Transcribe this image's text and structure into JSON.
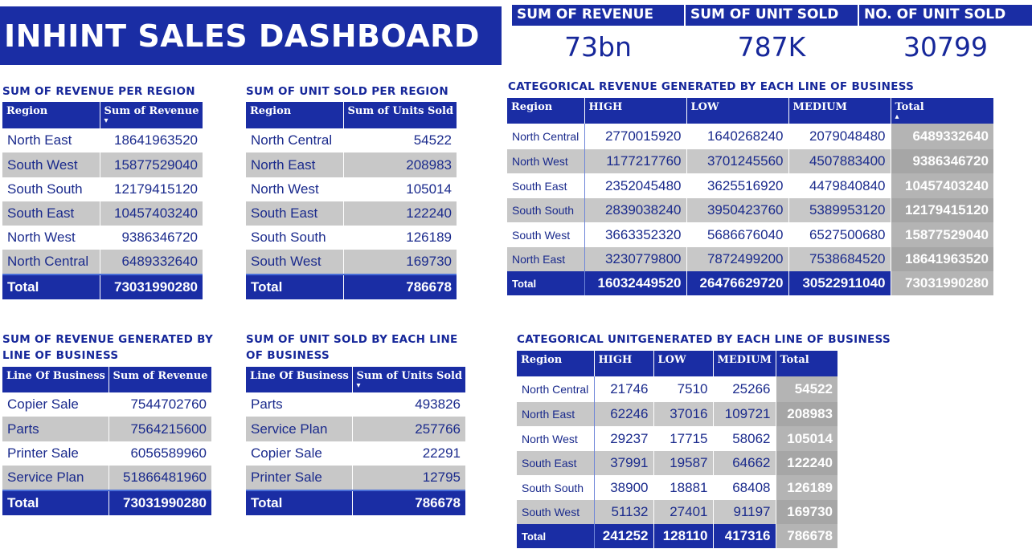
{
  "dashboard_title": "INHINT SALES DASHBOARD",
  "kpis": [
    {
      "label": "SUM OF REVENUE",
      "value": "73bn"
    },
    {
      "label": "SUM OF UNIT SOLD",
      "value": "787K"
    },
    {
      "label": "NO. OF UNIT SOLD",
      "value": "30799"
    }
  ],
  "revenue_by_region": {
    "title": "SUM OF REVENUE PER REGION",
    "headers": [
      "Region",
      "Sum of Revenue"
    ],
    "rows": [
      [
        "North East",
        "18641963520"
      ],
      [
        "South West",
        "15877529040"
      ],
      [
        "South South",
        "12179415120"
      ],
      [
        "South East",
        "10457403240"
      ],
      [
        "North West",
        "9386346720"
      ],
      [
        "North Central",
        "6489332640"
      ]
    ],
    "total": [
      "Total",
      "73031990280"
    ]
  },
  "units_by_region": {
    "title": "SUM OF UNIT SOLD PER REGION",
    "headers": [
      "Region",
      "Sum of Units Sold"
    ],
    "rows": [
      [
        "North Central",
        "54522"
      ],
      [
        "North East",
        "208983"
      ],
      [
        "North West",
        "105014"
      ],
      [
        "South East",
        "122240"
      ],
      [
        "South South",
        "126189"
      ],
      [
        "South West",
        "169730"
      ]
    ],
    "total": [
      "Total",
      "786678"
    ]
  },
  "revenue_by_lob": {
    "title_line1": "SUM OF REVENUE GENERATED BY",
    "title_line2": "LINE OF BUSINESS",
    "headers": [
      "Line Of Business",
      "Sum of Revenue"
    ],
    "rows": [
      [
        "Copier Sale",
        "7544702760"
      ],
      [
        "Parts",
        "7564215600"
      ],
      [
        "Printer Sale",
        "6056589960"
      ],
      [
        "Service Plan",
        "51866481960"
      ]
    ],
    "total": [
      "Total",
      "73031990280"
    ]
  },
  "units_by_lob": {
    "title_line1": "SUM OF UNIT SOLD BY EACH LINE",
    "title_line2": "OF BUSINESS",
    "headers": [
      "Line Of Business",
      "Sum of Units Sold"
    ],
    "rows": [
      [
        "Parts",
        "493826"
      ],
      [
        "Service Plan",
        "257766"
      ],
      [
        "Copier Sale",
        "22291"
      ],
      [
        "Printer Sale",
        "12795"
      ]
    ],
    "total": [
      "Total",
      "786678"
    ]
  },
  "revenue_matrix": {
    "title": "CATEGORICAL REVENUE GENERATED BY EACH LINE OF BUSINESS",
    "headers": [
      "Region",
      "HIGH",
      "LOW",
      "MEDIUM",
      "Total"
    ],
    "rows": [
      [
        "North Central",
        "2770015920",
        "1640268240",
        "2079048480",
        "6489332640"
      ],
      [
        "North West",
        "1177217760",
        "3701245560",
        "4507883400",
        "9386346720"
      ],
      [
        "South East",
        "2352045480",
        "3625516920",
        "4479840840",
        "10457403240"
      ],
      [
        "South South",
        "2839038240",
        "3950423760",
        "5389953120",
        "12179415120"
      ],
      [
        "South West",
        "3663352320",
        "5686676040",
        "6527500680",
        "15877529040"
      ],
      [
        "North East",
        "3230779800",
        "7872499200",
        "7538684520",
        "18641963520"
      ]
    ],
    "total": [
      "Total",
      "16032449520",
      "26476629720",
      "30522911040",
      "73031990280"
    ]
  },
  "unit_matrix": {
    "title": "CATEGORICAL UNITGENERATED BY EACH LINE OF BUSINESS",
    "headers": [
      "Region",
      "HIGH",
      "LOW",
      "MEDIUM",
      "Total"
    ],
    "rows": [
      [
        "North Central",
        "21746",
        "7510",
        "25266",
        "54522"
      ],
      [
        "North East",
        "62246",
        "37016",
        "109721",
        "208983"
      ],
      [
        "North West",
        "29237",
        "17715",
        "58062",
        "105014"
      ],
      [
        "South East",
        "37991",
        "19587",
        "64662",
        "122240"
      ],
      [
        "South South",
        "38900",
        "18881",
        "68408",
        "126189"
      ],
      [
        "South West",
        "51132",
        "27401",
        "91197",
        "169730"
      ]
    ],
    "total": [
      "Total",
      "241252",
      "128110",
      "417316",
      "786678"
    ]
  },
  "colors": {
    "brand_blue": "#1a2da4",
    "row_stripe": "#c8c8c8",
    "total_column_grey": "#b4b4b4"
  },
  "icons": {
    "sort_desc": "sort-down-arrow-icon",
    "sort_asc": "sort-up-arrow-icon"
  }
}
